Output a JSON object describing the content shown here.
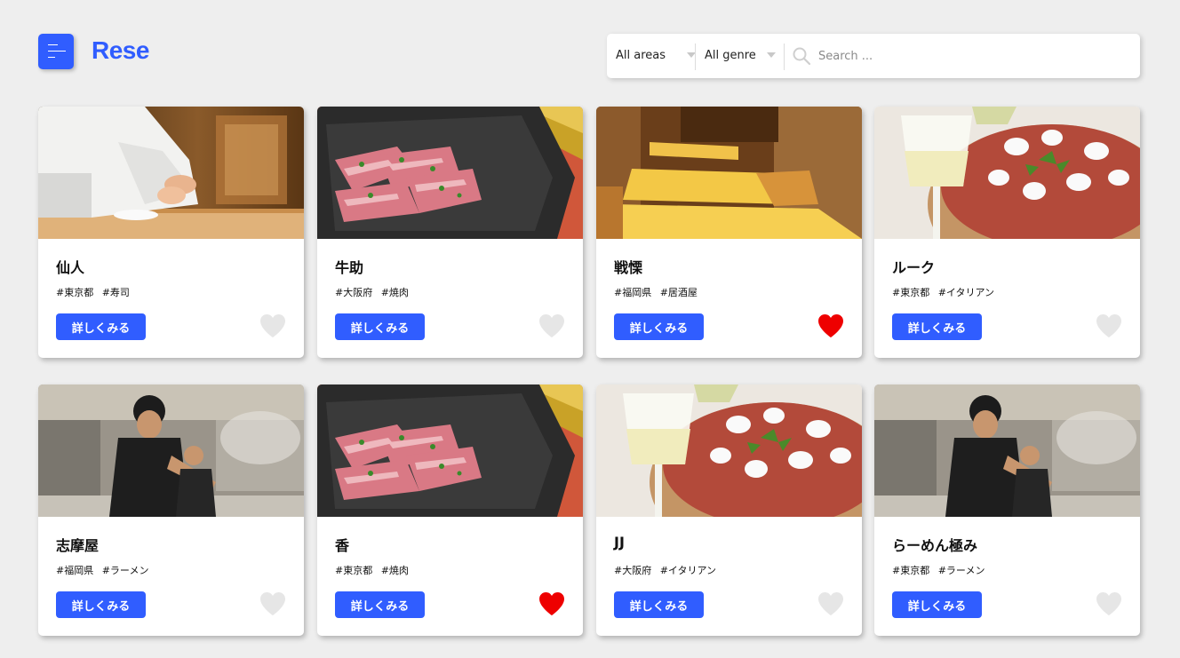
{
  "app": {
    "logo": "Rese"
  },
  "search": {
    "area_selected": "All areas",
    "genre_selected": "All genre",
    "placeholder": "Search ..."
  },
  "colors": {
    "accent": "#305dff",
    "favorite_on": "#ee0000",
    "favorite_off": "#e6e6e6"
  },
  "shops": [
    {
      "name": "仙人",
      "area_tag": "#東京都",
      "genre_tag": "#寿司",
      "button": "詳しくみる",
      "favorite": false,
      "photo": "sushi-chef"
    },
    {
      "name": "牛助",
      "area_tag": "#大阪府",
      "genre_tag": "#焼肉",
      "button": "詳しくみる",
      "favorite": false,
      "photo": "yakiniku-meat"
    },
    {
      "name": "戦慄",
      "area_tag": "#福岡県",
      "genre_tag": "#居酒屋",
      "button": "詳しくみる",
      "favorite": true,
      "photo": "izakaya-interior"
    },
    {
      "name": "ルーク",
      "area_tag": "#東京都",
      "genre_tag": "#イタリアン",
      "button": "詳しくみる",
      "favorite": false,
      "photo": "pizza-wine"
    },
    {
      "name": "志摩屋",
      "area_tag": "#福岡県",
      "genre_tag": "#ラーメン",
      "button": "詳しくみる",
      "favorite": false,
      "photo": "ramen-kitchen"
    },
    {
      "name": "香",
      "area_tag": "#東京都",
      "genre_tag": "#焼肉",
      "button": "詳しくみる",
      "favorite": true,
      "photo": "yakiniku-meat"
    },
    {
      "name": "JJ",
      "area_tag": "#大阪府",
      "genre_tag": "#イタリアン",
      "button": "詳しくみる",
      "favorite": false,
      "photo": "pizza-wine"
    },
    {
      "name": "らーめん極み",
      "area_tag": "#東京都",
      "genre_tag": "#ラーメン",
      "button": "詳しくみる",
      "favorite": false,
      "photo": "ramen-kitchen"
    }
  ]
}
